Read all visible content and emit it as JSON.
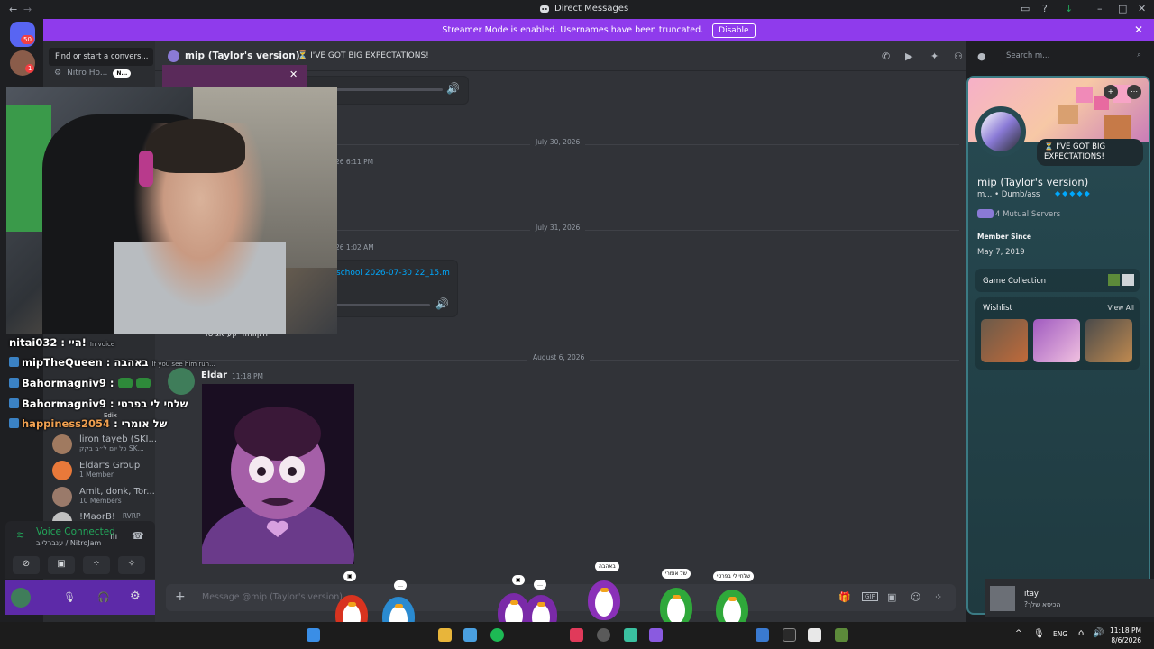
{
  "window": {
    "title": "Direct Messages"
  },
  "banner": {
    "text": "Streamer Mode is enabled. Usernames have been truncated.",
    "button": "Disable"
  },
  "rail": {
    "dm_badge": "50",
    "friend_badge": "1"
  },
  "sidebar": {
    "find_placeholder": "Find or start a convers...",
    "nitro_label": "Nitro Ho...",
    "nitro_badge": "N...",
    "dms": [
      {
        "name": "liron tayeb (SKI...",
        "sub": "כל יום ל״ב בקק SK..."
      },
      {
        "name": "Eldar's Group",
        "sub": "1 Member"
      },
      {
        "name": "Amit, donk, Tor...",
        "sub": "10 Members"
      },
      {
        "name": "!MaorB!",
        "sub": "RVRP"
      }
    ],
    "voice": {
      "status": "Voice Connected",
      "channel": "ענברלייב / NitroJam"
    }
  },
  "overlay_chat": [
    {
      "user": "nitai032",
      "msg": ": היי!",
      "extra": "In voice"
    },
    {
      "user": "mipTheQueen",
      "msg": ": באהבה",
      "extra": "If you see him run..."
    },
    {
      "user": "Bahormagniv9",
      "msg": ":",
      "extra": ""
    },
    {
      "user": "Bahormagniv9",
      "msg": ": שלחי לי בפרטי",
      "extra": ""
    },
    {
      "user": "happiness2054",
      "msg": ": של אומרי",
      "extra": "Edix"
    }
  ],
  "chat": {
    "recipient": "mip (Taylor's version)",
    "status": "⏳ I'VE GOT BIG EXPECTATIONS!",
    "search_placeholder": "Search m...",
    "dates": [
      "July 30, 2026",
      "July 31, 2026",
      "August 6, 2026"
    ],
    "ts1": "26 6:11 PM",
    "ts2": "26 1:02 AM",
    "file_name": "school 2026-07-30 22_15.m",
    "caption": "הקווהוד קע אג סו",
    "last_message": {
      "author": "Eldar",
      "time": "11:18 PM"
    },
    "composer_placeholder": "Message @mip (Taylor's version)"
  },
  "profile": {
    "status": "⏳ I'VE GOT BIG EXPECTATIONS!",
    "name": "mip (Taylor's version)",
    "tag": "m... • Dumb/ass",
    "mutual": "4 Mutual Servers",
    "member_since_label": "Member Since",
    "member_since": "May 7, 2019",
    "game_collection": "Game Collection",
    "wishlist": "Wishlist",
    "view_all": "View All"
  },
  "penguins": {
    "bubbles": [
      "באהבה",
      "של אומרי",
      "שלחי לי בפרטי"
    ]
  },
  "notification": {
    "user": "itay",
    "message": "?הכיסא שלך"
  },
  "taskbar": {
    "lang": "ENG",
    "time": "11:18 PM",
    "date": "8/6/2026"
  },
  "colors": {
    "banner": "#8f3bec",
    "online": "#23a55a",
    "profile_bg": "#274a52",
    "accent_blue": "#00a8fc"
  }
}
